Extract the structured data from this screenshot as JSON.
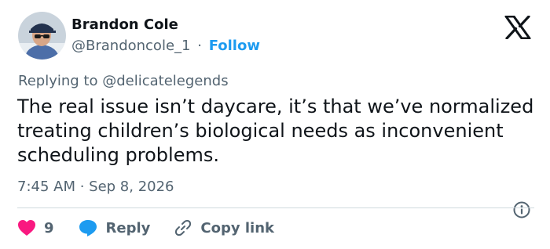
{
  "author": {
    "name": "Brandon Cole",
    "handle": "@Brandoncole_1",
    "separator": "·",
    "follow_label": "Follow"
  },
  "reply_context": {
    "prefix": "Replying to",
    "mention": "@delicatelegends"
  },
  "tweet": {
    "text": "The real issue isn’t daycare, it’s that we’ve normalized treating children’s biological needs as inconvenient scheduling problems.",
    "timestamp": "7:45 AM · Sep 8, 2026"
  },
  "actions": {
    "like_count": "9",
    "reply_label": "Reply",
    "copy_link_label": "Copy link"
  },
  "icons": {
    "brand": "x-logo-icon",
    "like": "heart-icon",
    "reply": "speech-bubble-icon",
    "copy": "link-icon",
    "info": "info-icon"
  },
  "colors": {
    "accent": "#1d9bf0",
    "like": "#f91880",
    "text": "#0f1419",
    "muted": "#536471"
  }
}
